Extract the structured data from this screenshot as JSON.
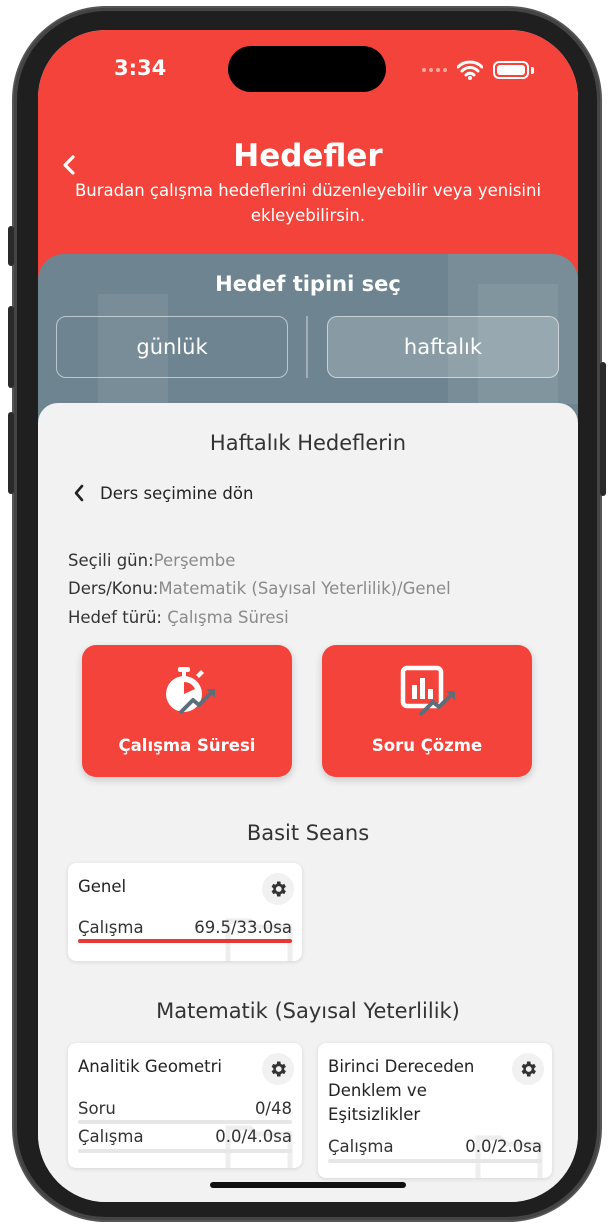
{
  "status_bar": {
    "time": "3:34"
  },
  "header": {
    "title": "Hedefler",
    "subtitle": "Buradan çalışma hedeflerini düzenleyebilir veya yenisini ekleyebilirsin."
  },
  "goal_type": {
    "title": "Hedef tipini seç",
    "options": [
      "günlük",
      "haftalık"
    ],
    "selected": "haftalık"
  },
  "weekly": {
    "title": "Haftalık Hedeflerin",
    "back_label": "Ders seçimine dön",
    "info": [
      {
        "label": "Seçili gün:",
        "value": "Perşembe"
      },
      {
        "label": "Ders/Konu:",
        "value": "Matematik (Sayısal Yeterlilik)/Genel"
      },
      {
        "label": "Hedef türü: ",
        "value": "Çalışma Süresi"
      }
    ],
    "goal_buttons": [
      {
        "label": "Çalışma Süresi",
        "icon": "stopwatch-icon"
      },
      {
        "label": "Soru Çözme",
        "icon": "chart-icon"
      }
    ]
  },
  "basic_session": {
    "title": "Basit Seans",
    "cards": [
      {
        "title": "Genel",
        "metrics": [
          {
            "label": "Çalışma",
            "value": "69.5/33.0sa",
            "progress": 1.0
          }
        ]
      }
    ]
  },
  "math_section": {
    "title": "Matematik (Sayısal Yeterlilik)",
    "cards": [
      {
        "title": "Analitik Geometri",
        "metrics": [
          {
            "label": "Soru",
            "value": "0/48",
            "progress": 0
          },
          {
            "label": "Çalışma",
            "value": "0.0/4.0sa",
            "progress": 0
          }
        ]
      },
      {
        "title": "Birinci Dereceden Denklem ve Eşitsizlikler",
        "metrics": [
          {
            "label": "Çalışma",
            "value": "0.0/2.0sa",
            "progress": 0
          }
        ]
      }
    ]
  },
  "colors": {
    "accent": "#f4433a",
    "panel": "#6e8591",
    "progress": "#e53935"
  }
}
